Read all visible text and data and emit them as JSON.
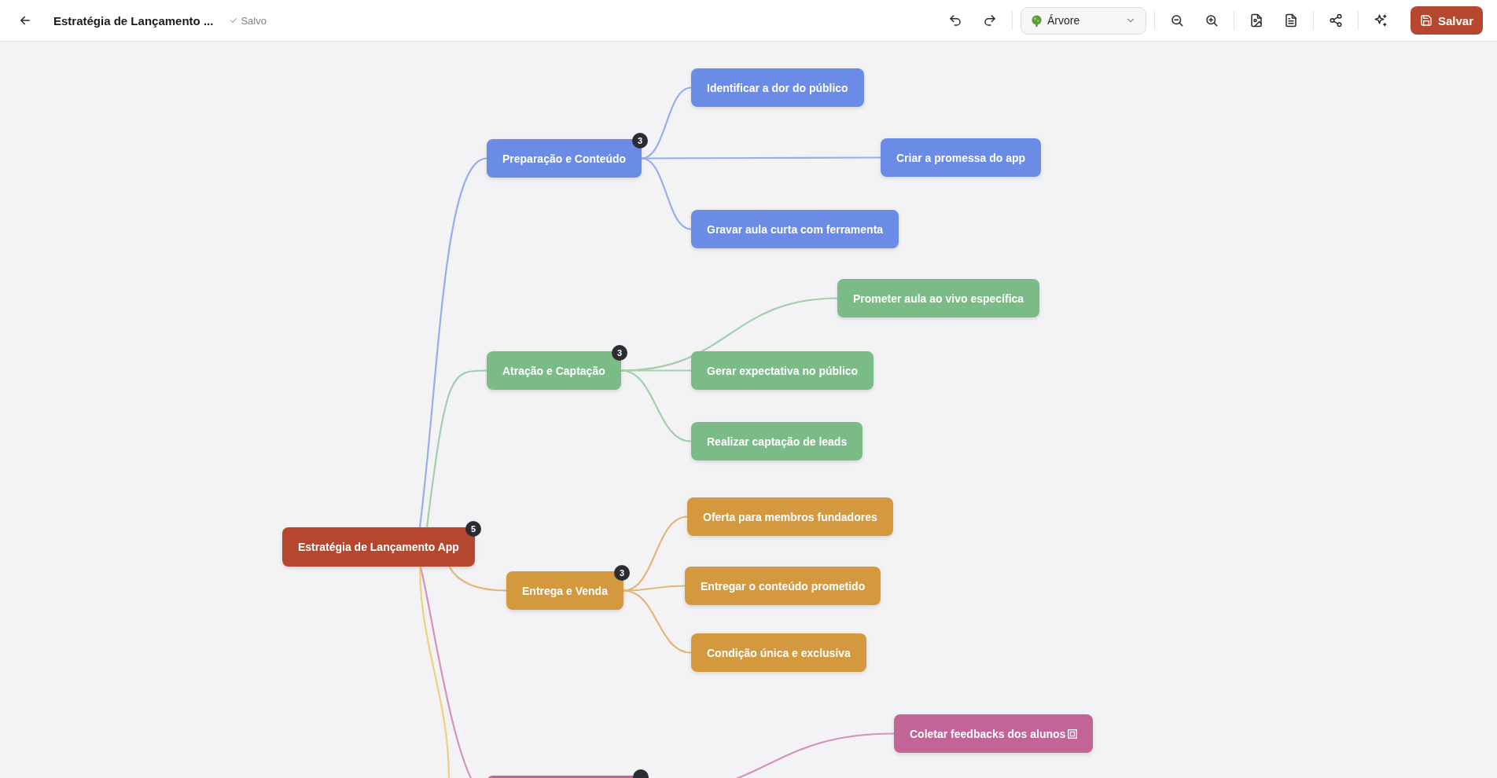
{
  "header": {
    "title": "Estratégia de Lançamento ...",
    "save_status": "Salvo",
    "view_select": {
      "value": "Árvore"
    },
    "save_button": "Salvar"
  },
  "mindmap": {
    "root": {
      "label": "Estratégia de Lançamento App",
      "badge": "5",
      "color": "#b5472e",
      "children": [
        {
          "label": "Preparação e Conteúdo",
          "badge": "3",
          "color": "#6a8be6",
          "children": [
            {
              "label": "Identificar a dor do público"
            },
            {
              "label": "Criar a promessa do app"
            },
            {
              "label": "Gravar aula curta com ferramenta"
            }
          ]
        },
        {
          "label": "Atração e Captação",
          "badge": "3",
          "color": "#7bbb88",
          "children": [
            {
              "label": "Prometer aula ao vivo específica"
            },
            {
              "label": "Gerar expectativa no público"
            },
            {
              "label": "Realizar captação de leads"
            }
          ]
        },
        {
          "label": "Entrega e Venda",
          "badge": "3",
          "color": "#d4983f",
          "children": [
            {
              "label": "Oferta para membros fundadores"
            },
            {
              "label": "Entregar o conteúdo prometido"
            },
            {
              "label": "Condição única e exclusiva"
            }
          ]
        },
        {
          "badge": true,
          "color": "#c26496",
          "children": [
            {
              "label": "Coletar feedbacks dos alunos",
              "trailing_icon": true
            }
          ]
        },
        {
          "color": "#ecd27a"
        }
      ]
    }
  }
}
